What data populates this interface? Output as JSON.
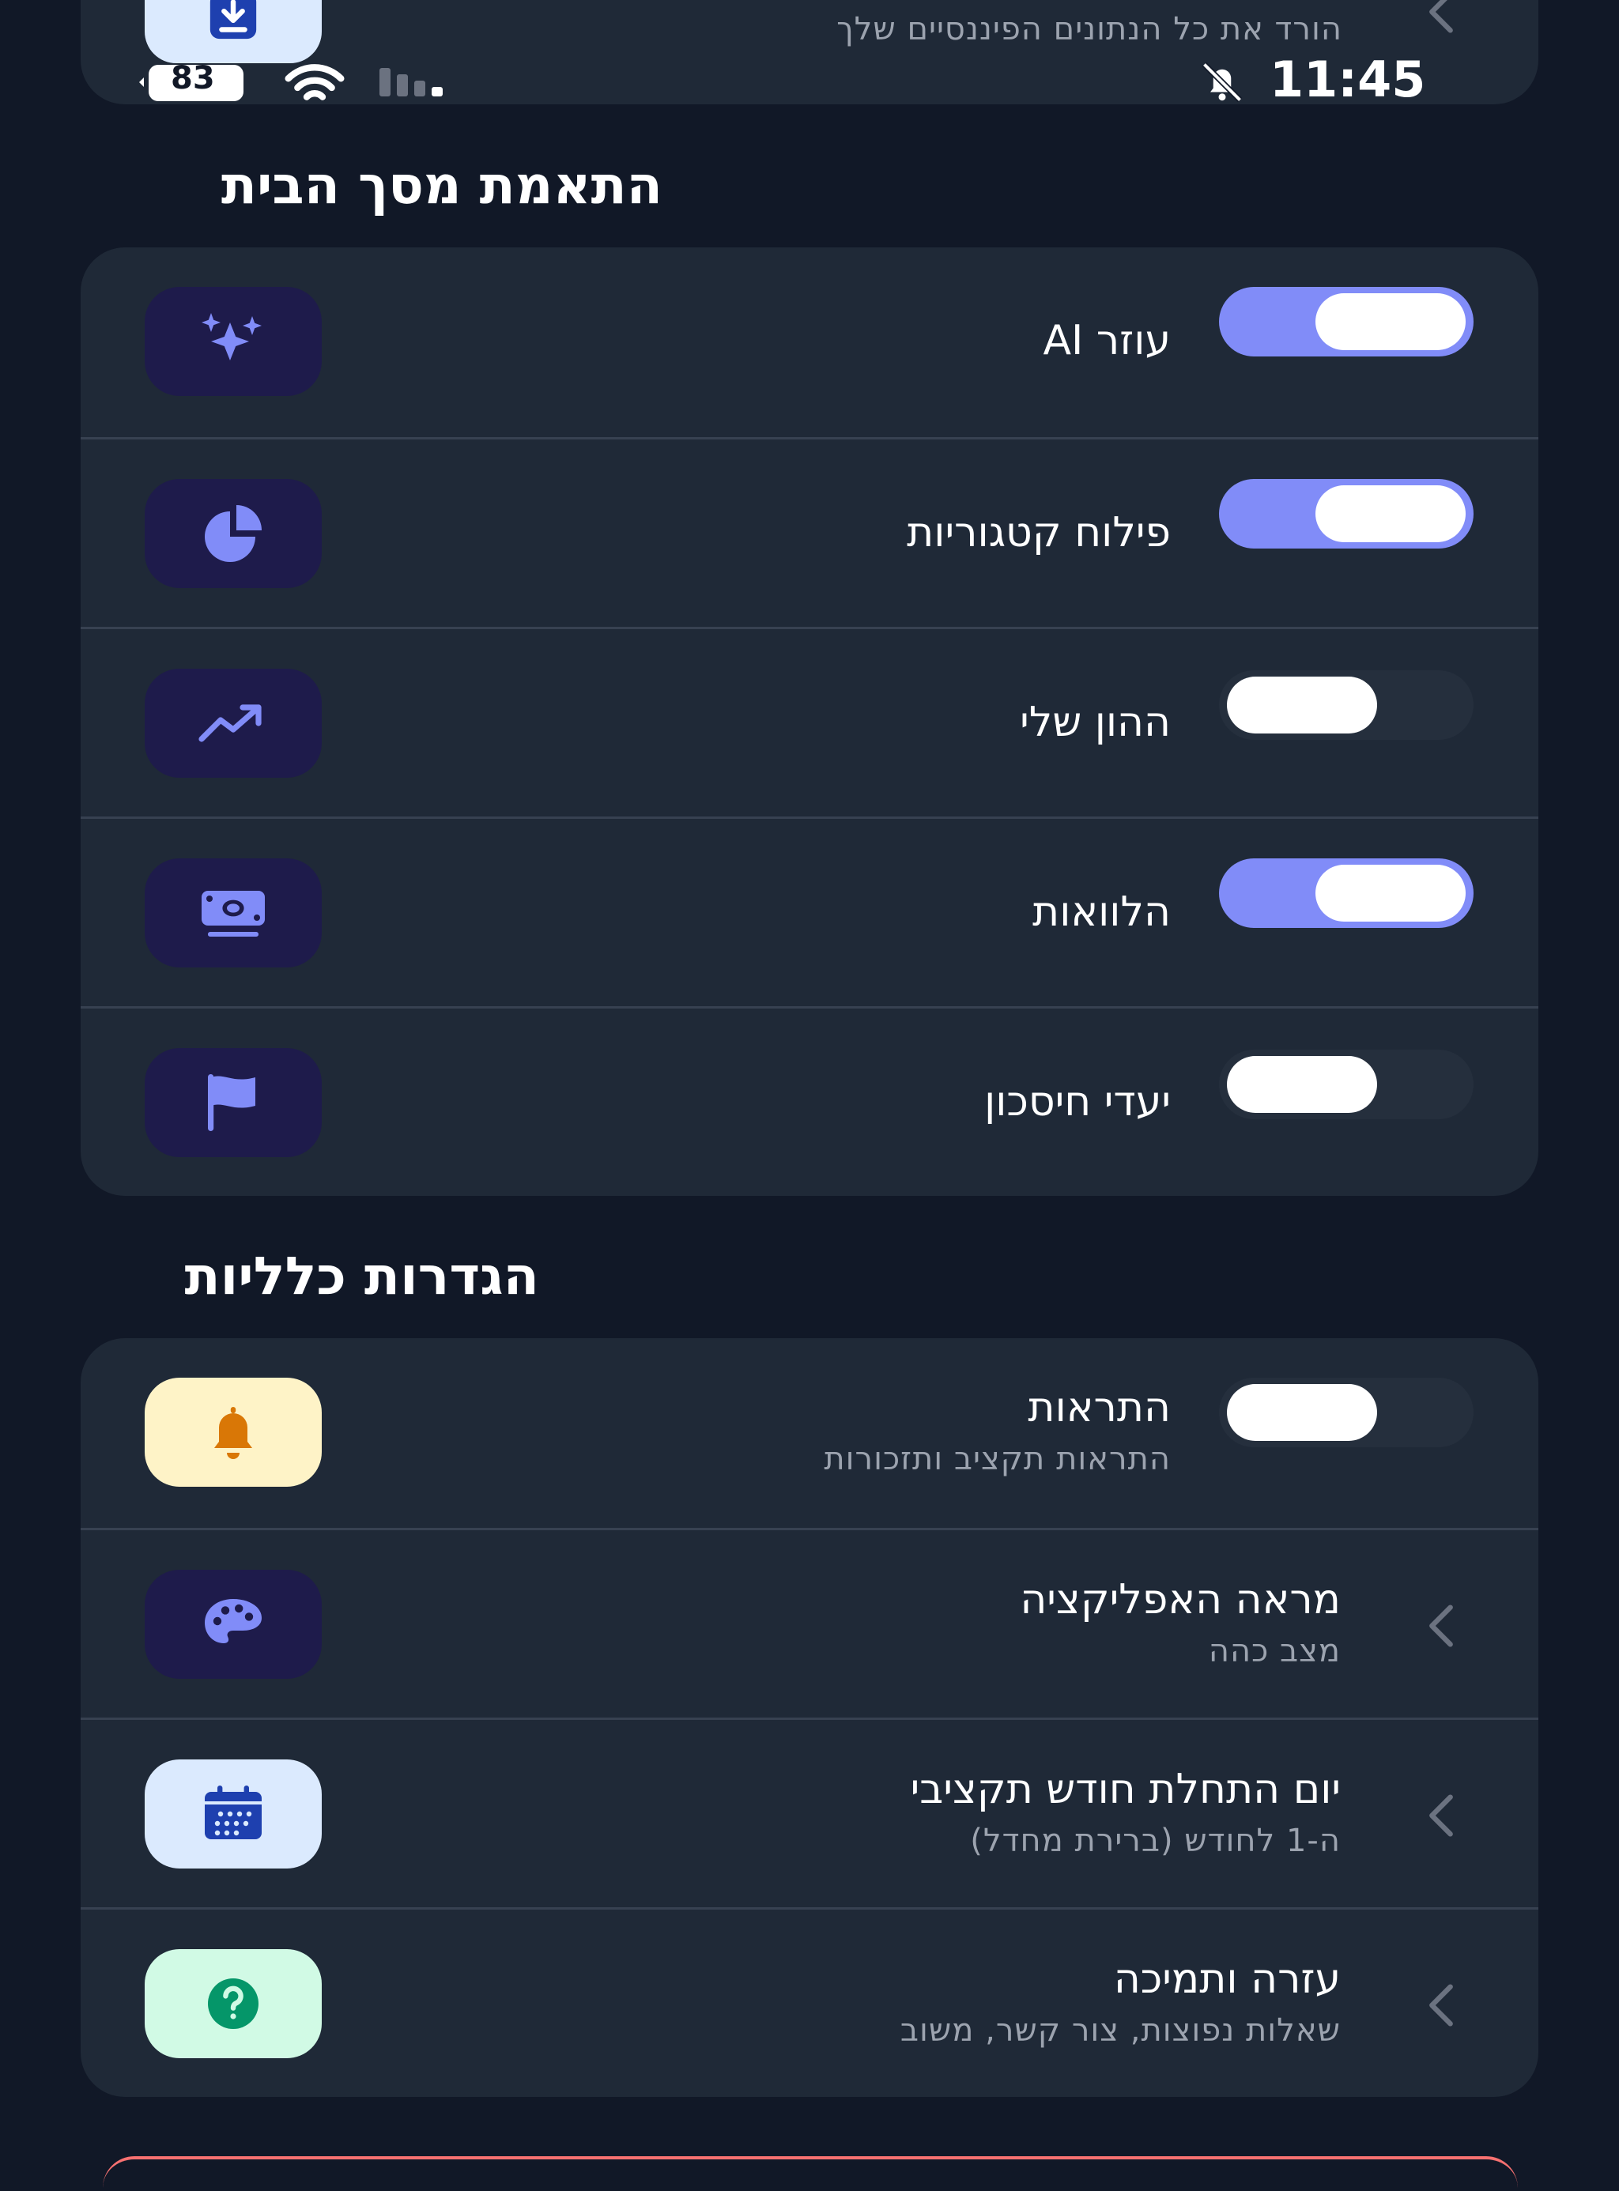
{
  "status_bar": {
    "time": "11:45",
    "battery": "83",
    "icons": [
      "battery-icon",
      "wifi-icon",
      "signal-icon",
      "bell-off-icon"
    ]
  },
  "export_row": {
    "subtitle": "הורד את כל הנתונים הפיננסיים שלך",
    "icon": "download-icon"
  },
  "home_section": {
    "title": "התאמת מסך הבית",
    "items": [
      {
        "label": "עוזר AI",
        "icon": "sparkles-icon",
        "enabled": true
      },
      {
        "label": "פילוח קטגוריות",
        "icon": "pie-chart-icon",
        "enabled": true
      },
      {
        "label": "ההון שלי",
        "icon": "trending-up-icon",
        "enabled": false
      },
      {
        "label": "הלוואות",
        "icon": "money-icon",
        "enabled": true
      },
      {
        "label": "יעדי חיסכון",
        "icon": "flag-icon",
        "enabled": false
      }
    ]
  },
  "general_section": {
    "title": "הגדרות כלליות",
    "items": [
      {
        "label": "התראות",
        "sublabel": "התראות תקציב ותזכורות",
        "icon": "bell-icon",
        "enabled": false
      },
      {
        "label": "מראה האפליקציה",
        "sublabel": "מצב כהה",
        "icon": "palette-icon"
      },
      {
        "label": "יום התחלת חודש תקציבי",
        "sublabel": "ה-1 לחודש (ברירת מחדל)",
        "icon": "calendar-icon"
      },
      {
        "label": "עזרה ותמיכה",
        "sublabel": "שאלות נפוצות, צור קשר, משוב",
        "icon": "help-icon"
      }
    ]
  },
  "colors": {
    "background": "#111827",
    "card": "#1f2937",
    "accent": "#818cf8",
    "icon_bg_dark": "#1e1b4b"
  }
}
